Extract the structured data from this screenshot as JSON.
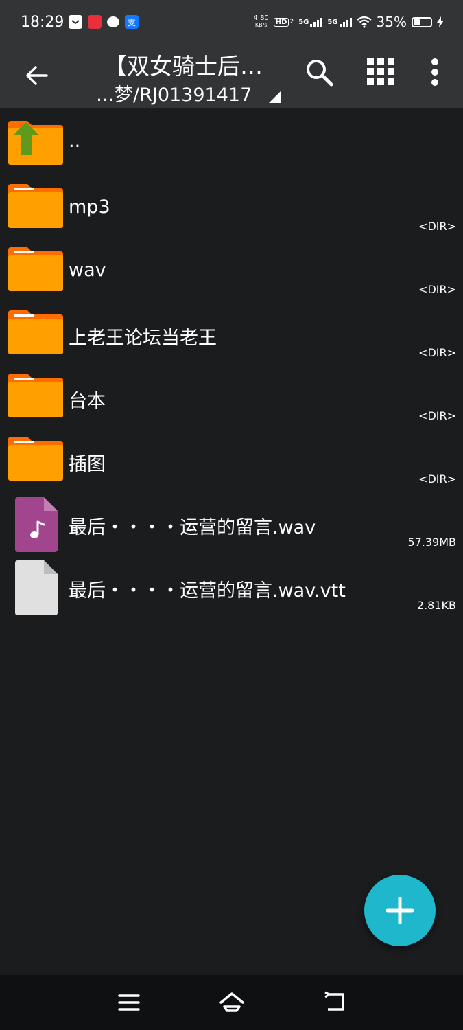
{
  "status": {
    "time": "18:29",
    "net_speed_value": "4.80",
    "net_speed_unit": "KB/s",
    "hd_label": "HD",
    "hd_sub": "2",
    "sim1": "5G",
    "sim2": "5G",
    "battery_pct": "35%",
    "app_colors": [
      "#ffffff",
      "#e8303a",
      "#ffffff",
      "#1677ff"
    ]
  },
  "appbar": {
    "title": "【双女骑士后…",
    "subtitle": "…梦/RJ01391417"
  },
  "files": [
    {
      "name": "..",
      "type": "up",
      "meta": ""
    },
    {
      "name": "mp3",
      "type": "folder",
      "meta": "<DIR>"
    },
    {
      "name": "wav",
      "type": "folder",
      "meta": "<DIR>"
    },
    {
      "name": "上老王论坛当老王",
      "type": "folder",
      "meta": "<DIR>"
    },
    {
      "name": "台本",
      "type": "folder",
      "meta": "<DIR>"
    },
    {
      "name": "插图",
      "type": "folder",
      "meta": "<DIR>"
    },
    {
      "name": "最后・・・・运营的留言.wav",
      "type": "audio",
      "meta": "57.39MB"
    },
    {
      "name": "最后・・・・运营的留言.wav.vtt",
      "type": "file",
      "meta": "2.81KB"
    }
  ],
  "colors": {
    "folder": "#ff9f00",
    "folder_tab": "#ff6d00",
    "audio_file": "#a2458f",
    "plain_file": "#e0e0e0",
    "fab": "#1fb7cc",
    "up_arrow": "#5f9a1d"
  },
  "icons": {
    "back": "arrow-left-icon",
    "search": "search-icon",
    "view": "grid-view-icon",
    "more": "more-vert-icon",
    "fab": "plus-icon",
    "nav": [
      "menu-icon",
      "home-icon",
      "back-nav-icon"
    ]
  }
}
